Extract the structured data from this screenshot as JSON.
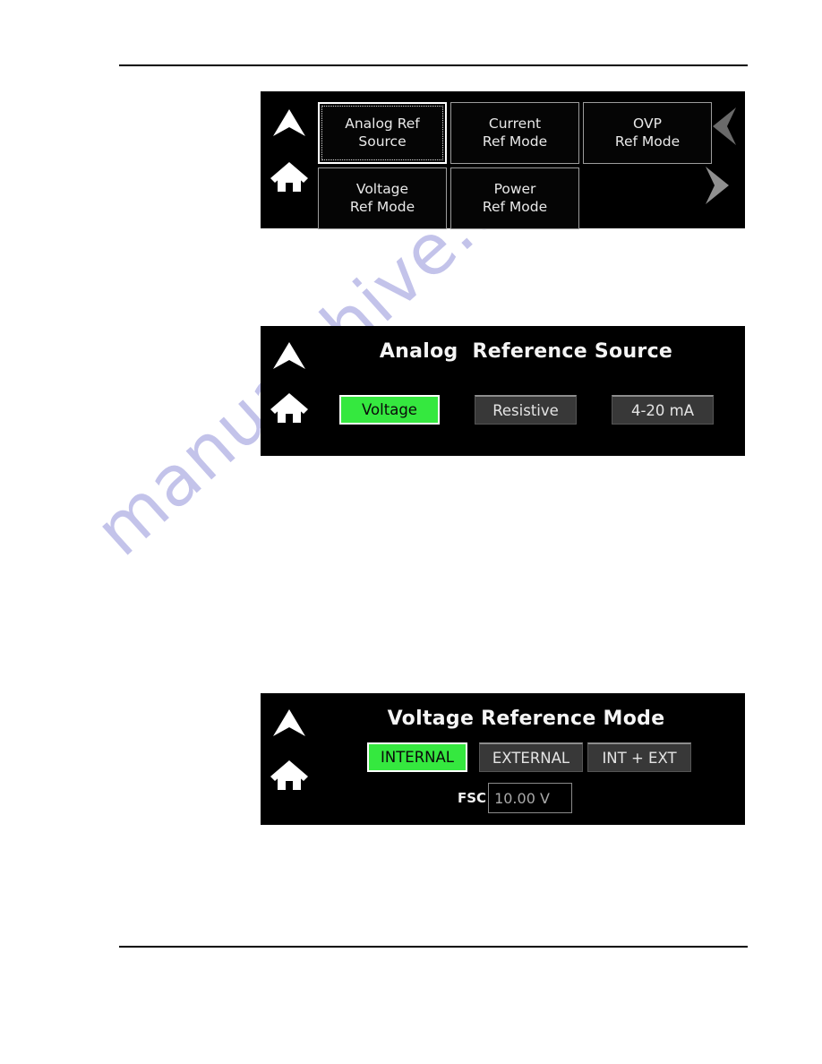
{
  "page": {
    "watermark": "manualshive.com",
    "background": "#ffffff",
    "rule_color": "#000000"
  },
  "colors": {
    "panel_background": "#000000",
    "active_green": "#35e83f",
    "inactive_gray": "#383838",
    "border_gray": "#9c9c9c",
    "text_light": "#e9e9e9",
    "chevron_gray": "#6a6a6a",
    "watermark": "#c3c3ea"
  },
  "panel_menu": {
    "nav": {
      "up_icon": "chevron-up-icon",
      "home_icon": "home-icon",
      "prev_icon": "chevron-left-icon",
      "next_icon": "chevron-right-icon"
    },
    "buttons": [
      {
        "line1": "Analog Ref",
        "line2": "Source",
        "selected": true
      },
      {
        "line1": "Current",
        "line2": "Ref Mode",
        "selected": false
      },
      {
        "line1": "OVP",
        "line2": "Ref Mode",
        "selected": false
      },
      {
        "line1": "Voltage",
        "line2": "Ref Mode",
        "selected": false
      },
      {
        "line1": "Power",
        "line2": "Ref Mode",
        "selected": false
      }
    ]
  },
  "panel_source": {
    "title": "Analog  Reference Source",
    "nav": {
      "up_icon": "chevron-up-icon",
      "home_icon": "home-icon"
    },
    "options": [
      {
        "label": "Voltage",
        "active": true
      },
      {
        "label": "Resistive",
        "active": false
      },
      {
        "label": "4-20 mA",
        "active": false
      }
    ]
  },
  "panel_vref": {
    "title": "Voltage Reference Mode",
    "nav": {
      "up_icon": "chevron-up-icon",
      "home_icon": "home-icon"
    },
    "options": [
      {
        "label": "INTERNAL",
        "active": true
      },
      {
        "label": "EXTERNAL",
        "active": false
      },
      {
        "label": "INT + EXT",
        "active": false
      }
    ],
    "fsc": {
      "label": "FSC",
      "value": "10.00 V"
    }
  }
}
